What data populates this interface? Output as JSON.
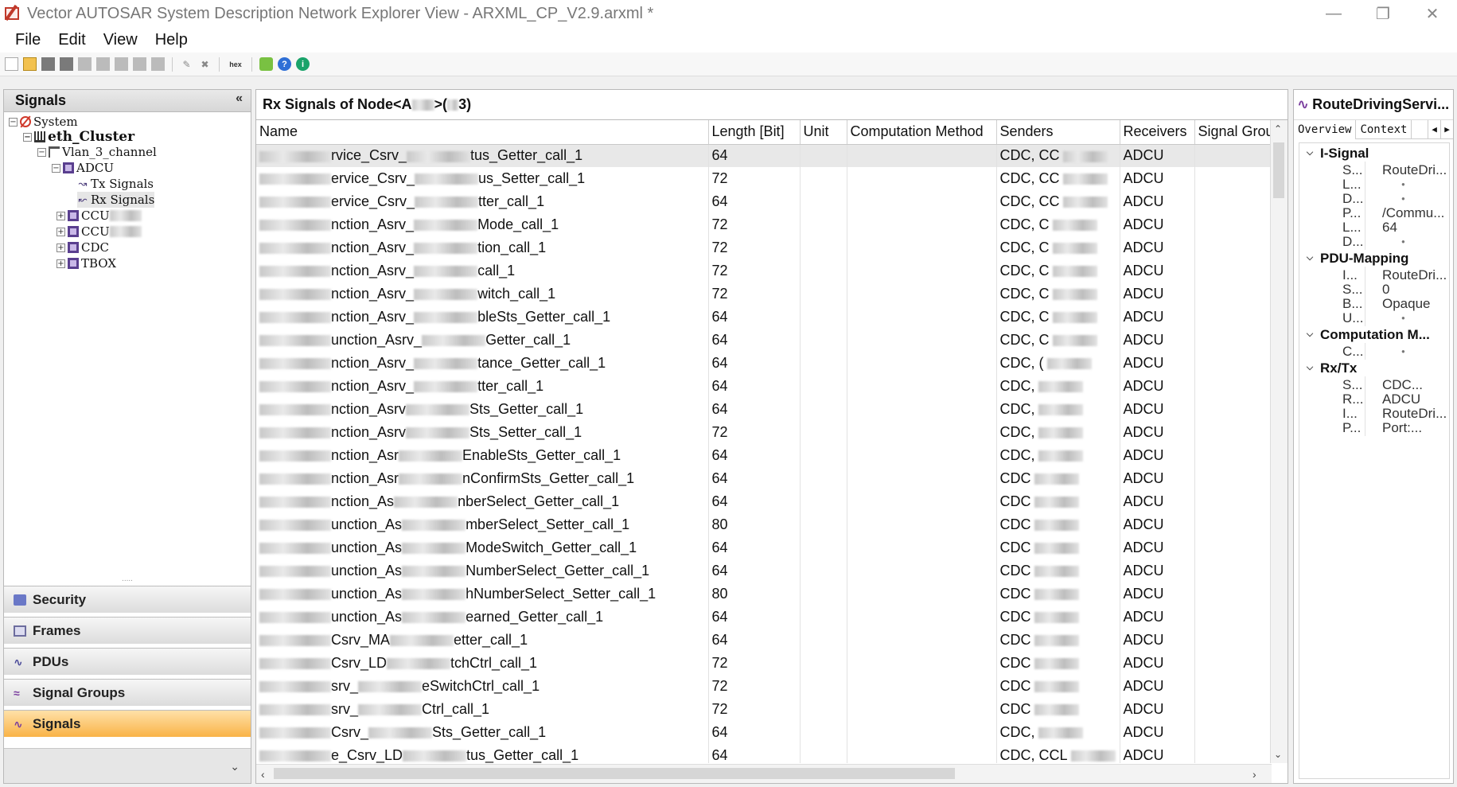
{
  "window": {
    "title": "Vector AUTOSAR System Description Network Explorer View - ARXML_CP_V2.9.arxml *",
    "minimize": "—",
    "maximize": "❐",
    "close": "✕"
  },
  "menu": [
    "File",
    "Edit",
    "View",
    "Help"
  ],
  "toolbar": {
    "hex_label": "hex",
    "help": "?",
    "info": "i"
  },
  "left_panel": {
    "title": "Signals",
    "collapse": "«",
    "tree": {
      "system": "System",
      "cluster": "eth_Cluster",
      "channel": "Vlan_3_channel",
      "adcu": "ADCU",
      "tx": "Tx Signals",
      "rx": "Rx Signals",
      "ccu1": "CCU",
      "ccu2": "CCU",
      "cdc": "CDC",
      "tbox": "TBOX"
    },
    "nav": {
      "security": "Security",
      "frames": "Frames",
      "pdus": "PDUs",
      "signal_groups": "Signal Groups",
      "signals": "Signals"
    },
    "bottom_chevron": "⌄"
  },
  "center": {
    "title_prefix": "Rx Signals of Node<A",
    "title_mid": ">(",
    "title_suffix": "3)",
    "columns": [
      "Name",
      "Length [Bit]",
      "Unit",
      "Computation Method",
      "Senders",
      "Receivers",
      "Signal Group"
    ],
    "rows": [
      {
        "pre": "rvice_Csrv_",
        "post": "tus_Getter_call_1",
        "len": "64",
        "snd": "CDC, CC",
        "rcv": "ADCU"
      },
      {
        "pre": "ervice_Csrv_",
        "post": "us_Setter_call_1",
        "len": "72",
        "snd": "CDC, CC",
        "rcv": "ADCU"
      },
      {
        "pre": "ervice_Csrv_",
        "post": "tter_call_1",
        "len": "64",
        "snd": "CDC, CC",
        "rcv": "ADCU"
      },
      {
        "pre": "nction_Asrv_",
        "post": "Mode_call_1",
        "len": "72",
        "snd": "CDC, C",
        "rcv": "ADCU"
      },
      {
        "pre": "nction_Asrv_",
        "post": "tion_call_1",
        "len": "72",
        "snd": "CDC, C",
        "rcv": "ADCU"
      },
      {
        "pre": "nction_Asrv_",
        "post": "call_1",
        "len": "72",
        "snd": "CDC, C",
        "rcv": "ADCU"
      },
      {
        "pre": "nction_Asrv_",
        "post": "witch_call_1",
        "len": "72",
        "snd": "CDC, C",
        "rcv": "ADCU"
      },
      {
        "pre": "nction_Asrv_",
        "post": "bleSts_Getter_call_1",
        "len": "64",
        "snd": "CDC, C",
        "rcv": "ADCU"
      },
      {
        "pre": "unction_Asrv_",
        "post": "Getter_call_1",
        "len": "64",
        "snd": "CDC, C",
        "rcv": "ADCU"
      },
      {
        "pre": "nction_Asrv_",
        "post": "tance_Getter_call_1",
        "len": "64",
        "snd": "CDC, (",
        "rcv": "ADCU"
      },
      {
        "pre": "nction_Asrv_",
        "post": "tter_call_1",
        "len": "64",
        "snd": "CDC,",
        "rcv": "ADCU"
      },
      {
        "pre": "nction_Asrv",
        "post": "Sts_Getter_call_1",
        "len": "64",
        "snd": "CDC,",
        "rcv": "ADCU"
      },
      {
        "pre": "nction_Asrv",
        "post": "Sts_Setter_call_1",
        "len": "72",
        "snd": "CDC,",
        "rcv": "ADCU"
      },
      {
        "pre": "nction_Asr",
        "post": "EnableSts_Getter_call_1",
        "len": "64",
        "snd": "CDC,",
        "rcv": "ADCU"
      },
      {
        "pre": "nction_Asr",
        "post": "nConfirmSts_Getter_call_1",
        "len": "64",
        "snd": "CDC",
        "rcv": "ADCU"
      },
      {
        "pre": "nction_As",
        "post": "nberSelect_Getter_call_1",
        "len": "64",
        "snd": "CDC",
        "rcv": "ADCU"
      },
      {
        "pre": "unction_As",
        "post": "mberSelect_Setter_call_1",
        "len": "80",
        "snd": "CDC",
        "rcv": "ADCU"
      },
      {
        "pre": "unction_As",
        "post": "ModeSwitch_Getter_call_1",
        "len": "64",
        "snd": "CDC",
        "rcv": "ADCU"
      },
      {
        "pre": "unction_As",
        "post": "NumberSelect_Getter_call_1",
        "len": "64",
        "snd": "CDC",
        "rcv": "ADCU"
      },
      {
        "pre": "unction_As",
        "post": "hNumberSelect_Setter_call_1",
        "len": "80",
        "snd": "CDC",
        "rcv": "ADCU"
      },
      {
        "pre": "unction_As",
        "post": "earned_Getter_call_1",
        "len": "64",
        "snd": "CDC",
        "rcv": "ADCU"
      },
      {
        "pre": "Csrv_MA",
        "post": "etter_call_1",
        "len": "64",
        "snd": "CDC",
        "rcv": "ADCU"
      },
      {
        "pre": "Csrv_LD",
        "post": "tchCtrl_call_1",
        "len": "72",
        "snd": "CDC",
        "rcv": "ADCU"
      },
      {
        "pre": "srv_",
        "post": "eSwitchCtrl_call_1",
        "len": "72",
        "snd": "CDC",
        "rcv": "ADCU"
      },
      {
        "pre": "srv_",
        "post": "Ctrl_call_1",
        "len": "72",
        "snd": "CDC",
        "rcv": "ADCU"
      },
      {
        "pre": "Csrv_",
        "post": "Sts_Getter_call_1",
        "len": "64",
        "snd": "CDC,",
        "rcv": "ADCU"
      },
      {
        "pre": "e_Csrv_LD",
        "post": "tus_Getter_call_1",
        "len": "64",
        "snd": "CDC, CCL",
        "rcv": "ADCU"
      }
    ]
  },
  "right": {
    "title": "RouteDrivingServi...",
    "tabs": [
      "Overview",
      "Context"
    ],
    "sections": [
      {
        "name": "I-Signal",
        "rows": [
          {
            "k": "S...",
            "v": "RouteDri..."
          },
          {
            "k": "L...",
            "v": ""
          },
          {
            "k": "D...",
            "v": ""
          },
          {
            "k": "P...",
            "v": "/Commu..."
          },
          {
            "k": "L...",
            "v": "64"
          },
          {
            "k": "D...",
            "v": ""
          }
        ]
      },
      {
        "name": "PDU-Mapping",
        "rows": [
          {
            "k": "I...",
            "v": "RouteDri..."
          },
          {
            "k": "S...",
            "v": "0"
          },
          {
            "k": "B...",
            "v": "Opaque"
          },
          {
            "k": "U...",
            "v": ""
          }
        ]
      },
      {
        "name": "Computation M...",
        "rows": [
          {
            "k": "C...",
            "v": ""
          }
        ]
      },
      {
        "name": "Rx/Tx",
        "rows": [
          {
            "k": "S...",
            "v": "CDC..."
          },
          {
            "k": "R...",
            "v": "ADCU"
          },
          {
            "k": "I...",
            "v": "RouteDri..."
          },
          {
            "k": "P...",
            "v": "Port:..."
          }
        ]
      }
    ]
  }
}
